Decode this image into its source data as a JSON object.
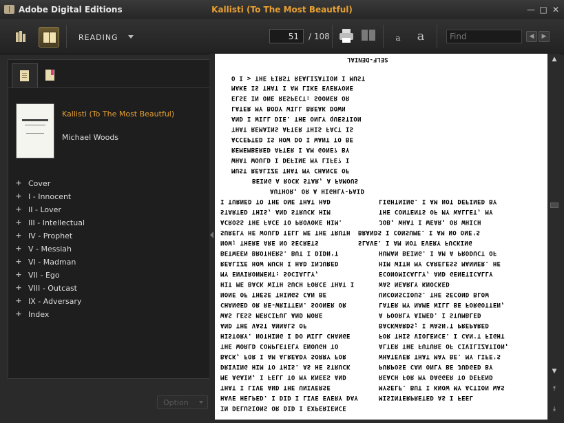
{
  "app": {
    "name": "Adobe Digital Editions",
    "document_title": "Kallisti (To The Most Beautful)",
    "window_controls": [
      "minimize-icon",
      "maximize-icon",
      "close-icon"
    ]
  },
  "toolbar": {
    "view_mode": "READING",
    "current_page": "51",
    "total_pages": "/ 108",
    "font_small": "a",
    "font_large": "a",
    "find_placeholder": "Find",
    "find_prev": "◀",
    "find_next": "▶"
  },
  "sidebar": {
    "book_title": "Kallisti (To The Most Beautful)",
    "author": "Michael Woods",
    "toc": [
      "Cover",
      "I - Innocent",
      "II - Lover",
      "III - Intellectual",
      "IV - Prophet",
      "V - Messiah",
      "VI - Madman",
      "VII - Ego",
      "VIII - Outcast",
      "IX - Adversary",
      "Index"
    ],
    "option_label": "Option"
  },
  "page": {
    "heading": "SELF-DENIAL",
    "lines": [
      "O I > THE FIRST REALIZATION I MUST",
      "MAKE IS THAT I AM LIKE EVERYONE",
      "ELSE IN ONE RESPECT: SOONER OR",
      "LATER MY BODY WILL BREAK DOWN",
      "AND I WILL DIE. THE ONLY QUESTION",
      "THAT REMAINS AFTER THIS FACT IS",
      "ACCEPTED IS HOW DO I WANT TO BE",
      "REMEMBERED AFTER I AM GONE? BY",
      "WHAT WOULD I DEFINE MY LIFE? I",
      "MUST REALIZE THAT MY CHANCE OF",
      "BEING A ROCK STAR, A FAMOUS",
      "AUTHOR, OR A HIGHLY-PAID",
      "I TURNED TO THE ONE THAT HAD",
      "LIGHTNING. I AM NOT DEFINED BY",
      "STARTED THIS, AND STRUCK HIM",
      "THE CONTENTS OF MY WALLET, MY",
      "ACROSS THE FACE TO PROVOKE HIM.",
      "JOB, WHAT I WEAR, OR WHICH",
      "SURELY HE WOULD TELL ME THE TRUTH",
      "BRANDS I CONSUME. I AM NO ONE'S",
      "NOW; THERE ARE NO SECRETS",
      "SLAVE. I AM NOT EVERY FUCKING",
      "BETWEEN BROTHERS. BUT I DIDN'T",
      "HUMAN BEING. I AM A PRODUCT OF",
      "REALIZE HOW MUCH I HAD INJURED",
      "HIM WITH MY CARELESS MANNER. HE",
      "MY ENVIRONMENT: SOCIALLY,",
      "ECONOMICALLY, AND GENETICALLY",
      "HIT ME BACK WITH SUCH FORCE THAT I",
      "WAS NEARLY KNOCKED",
      "NONE OF THESE THINGS CAN BE",
      "UNCONSCIOUS. THE SECOND BLOW",
      "CHANGED OR RE-WRITTEN. SOONER OR",
      "LATER MY NAME WILL BE FORGOTTEN,",
      "WAS LESS MERCIFUL AND MORE",
      "A POORLY AIMED. I STUMBLED",
      "AND THE VAST ANNALS OF",
      "BACKWARDS; I WASN'T PREPARED",
      "HISTORY. NOTHING I DO WILL CHANGE",
      "FOR THIS VIOLENCE. I CAN'T FIGHT",
      "THE WORLD COMPLETELY ENOUGH TO",
      "ALTER THE FUTURE OF CIVILIZATION,",
      "BACK, FOR I AM ALREADY SORRY FOR",
      "WHATEVER THAT MAY BE. MY LIFE'S",
      "DRIVING HIM TO THIS. AS HE STRUCK",
      "PURPOSE CAN ONLY BE JUDGED BY",
      "ME AGAIN, I FELL TO MY KNEES AND",
      "REACH FOR MY DAGGER TO DEFEND",
      "THAT I LIVE AND THE UNIVERSE",
      "MYSELF. BUT I KNOW MY ACTION WAS",
      "HAVE HELPED. I DID I LIVE EVERY DAY",
      "MISINTERPRETED AS I FEEL",
      "IN DELUSIONS OR DID I EXPERIENCE"
    ]
  },
  "scrollbar": {
    "up": "▲",
    "down": "▼",
    "top": "⤒",
    "bottom": "⤓"
  }
}
